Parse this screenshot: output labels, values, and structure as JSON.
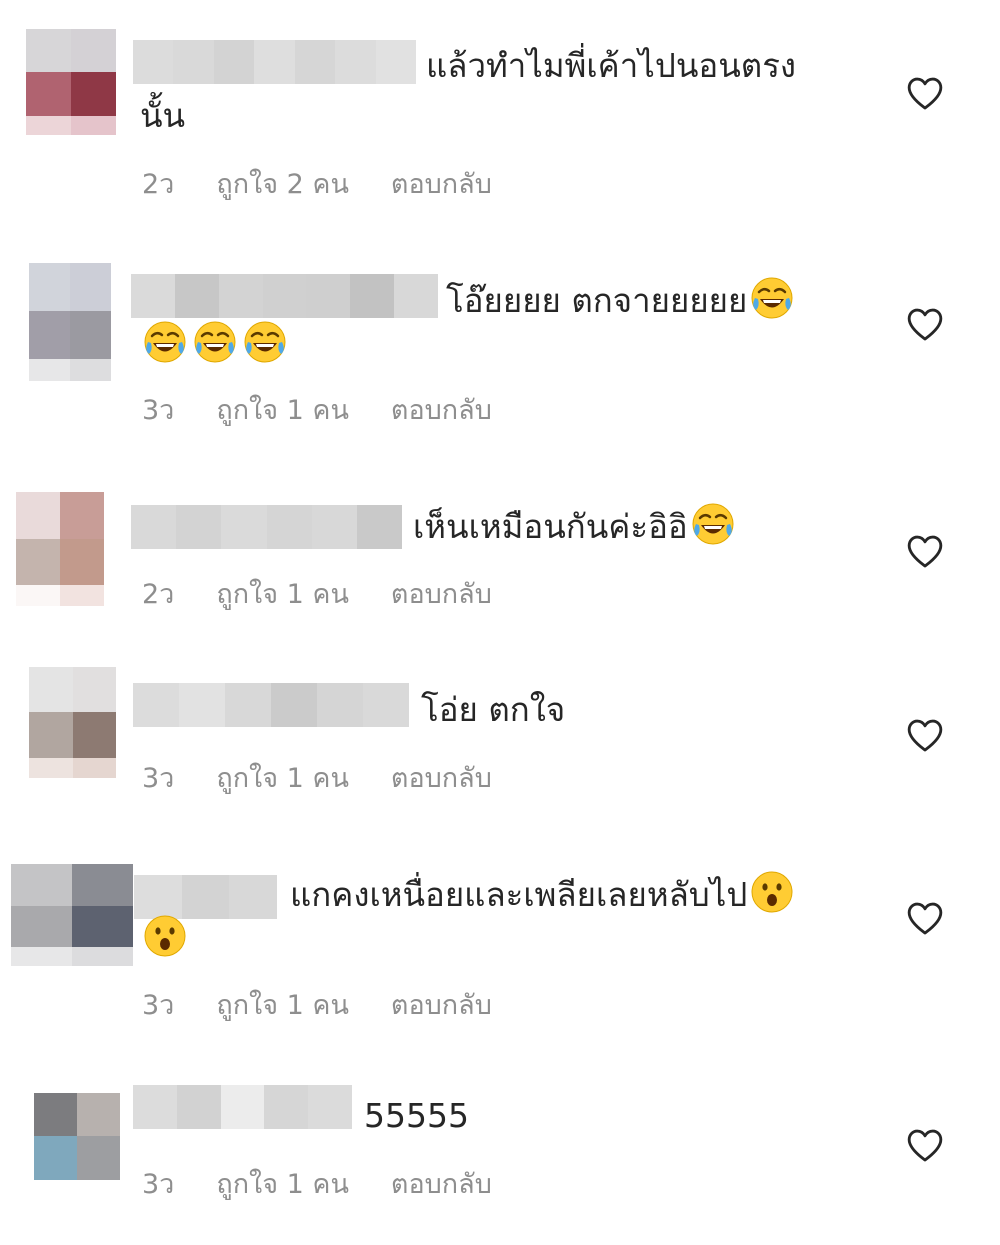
{
  "comments": [
    {
      "text_line1": "แล้วทำไมพี่เค้าไปนอนตรง",
      "text_line2": "นั้น",
      "emoji_line1": [],
      "emoji_line2": [],
      "age": "2ว",
      "likes": "ถูกใจ 2 คน",
      "reply": "ตอบกลับ",
      "avatar_colors": [
        "#d7d6d8",
        "#d4d1d5",
        "#b06370",
        "#8f3846",
        "#ecd5d8",
        "#e5c4cb"
      ],
      "username_colors": [
        "#dcdcdc",
        "#d9d9d9",
        "#d3d3d3",
        "#dedede",
        "#d6d6d6",
        "#dcdcdc",
        "#e1e1e1"
      ]
    },
    {
      "text_line1": "โอ๊ยยยย ตกจายยยยย",
      "text_line2": "",
      "emoji_line1": [
        "face-with-tears-of-joy-icon"
      ],
      "emoji_line2": [
        "face-with-tears-of-joy-icon",
        "face-with-tears-of-joy-icon",
        "face-with-tears-of-joy-icon"
      ],
      "age": "3ว",
      "likes": "ถูกใจ 1 คน",
      "reply": "ตอบกลับ",
      "avatar_colors": [
        "#d1d4db",
        "#ccced7",
        "#a19ea8",
        "#9b9aa1",
        "#e7e7e8",
        "#dddddf"
      ],
      "username_colors": [
        "#dadada",
        "#c7c7c7",
        "#d3d3d3",
        "#d0d0d0",
        "#cfcfcf",
        "#c2c2c2",
        "#d8d8d8"
      ]
    },
    {
      "text_line1": "เห็นเหมือนกันค่ะอิอิ",
      "text_line2": "",
      "emoji_line1": [
        "face-with-tears-of-joy-icon"
      ],
      "emoji_line2": [],
      "age": "2ว",
      "likes": "ถูกใจ 1 คน",
      "reply": "ตอบกลับ",
      "avatar_colors": [
        "#e9dada",
        "#c89d97",
        "#c4b4ad",
        "#c29a8c",
        "#fbf7f6",
        "#f2e3e0"
      ],
      "username_colors": [
        "#d9d9d9",
        "#d3d3d3",
        "#dadada",
        "#d5d5d5",
        "#d8d8d8",
        "#c9c9c9"
      ]
    },
    {
      "text_line1": "โอ่ย ตกใจ",
      "text_line2": "",
      "emoji_line1": [],
      "emoji_line2": [],
      "age": "3ว",
      "likes": "ถูกใจ 1 คน",
      "reply": "ตอบกลับ",
      "avatar_colors": [
        "#e4e4e4",
        "#e1dfdf",
        "#b1a6a0",
        "#8d7a72",
        "#ede3df",
        "#e5d6d0"
      ],
      "username_colors": [
        "#dcdcdc",
        "#e2e2e2",
        "#d8d8d8",
        "#cbcbcb",
        "#d5d5d5",
        "#d9d9d9"
      ]
    },
    {
      "text_line1": "แกคงเหนื่อยและเพลียเลยหลับไป",
      "text_line2": "",
      "emoji_line1": [
        "face-with-open-mouth-icon"
      ],
      "emoji_line2": [
        "face-with-open-mouth-icon"
      ],
      "age": "3ว",
      "likes": "ถูกใจ 1 คน",
      "reply": "ตอบกลับ",
      "avatar_colors": [
        "#c4c4c6",
        "#8a8c93",
        "#a9a9ac",
        "#5d6270",
        "#e7e7e8",
        "#dcdcde"
      ],
      "username_colors": [
        "#dddddd",
        "#d3d3d3",
        "#d8d8d8"
      ]
    },
    {
      "text_line1": "55555",
      "text_line2": "",
      "emoji_line1": [],
      "emoji_line2": [],
      "age": "3ว",
      "likes": "ถูกใจ 1 คน",
      "reply": "ตอบกลับ",
      "avatar_colors": [
        "#7c7c7f",
        "#b7b1ae",
        "#7fa8bd",
        "#9d9ea1",
        "#ffffff",
        "#ffffff"
      ],
      "username_colors": [
        "#dcdcdc",
        "#d2d2d2",
        "#ececec",
        "#d6d6d6",
        "#dbdbdb"
      ]
    }
  ],
  "heart_icon": "heart-outline-icon",
  "colors": {
    "text": "#262626",
    "meta": "#8e8e8e",
    "heart": "#262626"
  }
}
